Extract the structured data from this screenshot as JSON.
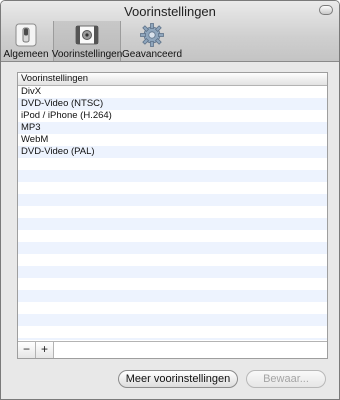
{
  "window": {
    "title": "Voorinstellingen"
  },
  "toolbar": {
    "items": [
      {
        "label": "Algemeen",
        "icon": "switch-icon"
      },
      {
        "label": "Voorinstellingen",
        "icon": "film-presets-icon",
        "selected": true
      },
      {
        "label": "Geavanceerd",
        "icon": "gear-icon"
      }
    ]
  },
  "presets": {
    "column_header": "Voorinstellingen",
    "items": [
      "DivX",
      "DVD-Video (NTSC)",
      "iPod / iPhone (H.264)",
      "MP3",
      "WebM",
      "DVD-Video (PAL)"
    ],
    "remove_label": "−",
    "add_label": "+"
  },
  "buttons": {
    "more_presets": "Meer voorinstellingen",
    "save": "Bewaar..."
  }
}
